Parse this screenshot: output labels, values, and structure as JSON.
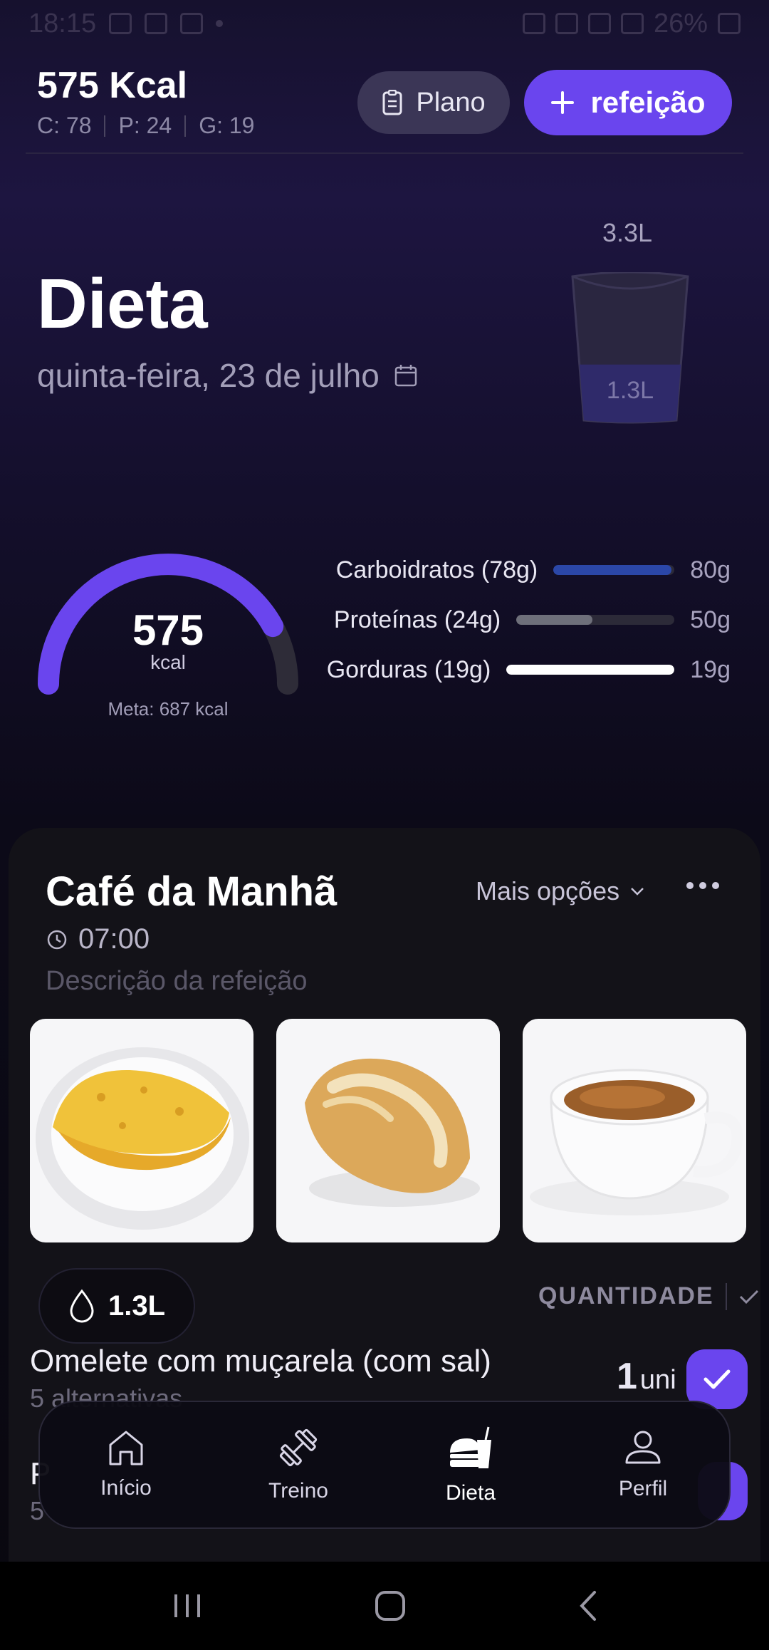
{
  "status_bar": {
    "time": "18:15",
    "battery": "26%"
  },
  "header": {
    "kcal": "575 Kcal",
    "macros": [
      "C: 78",
      "P: 24",
      "G: 19"
    ],
    "plano_label": "Plano",
    "add_meal_label": "refeição",
    "accent": "#6a45ee"
  },
  "page": {
    "title": "Dieta",
    "date": "quinta-feira, 23 de julho"
  },
  "water": {
    "goal": "3.3L",
    "current": "1.3L",
    "fill_fraction": 0.39
  },
  "calories": {
    "value": "575",
    "unit": "kcal",
    "goal_label": "Meta: 687 kcal",
    "fraction": 0.84
  },
  "macro_bars": [
    {
      "label": "Carboidratos (78g)",
      "goal": "80g",
      "fraction": 0.975,
      "color": "#2b47a8"
    },
    {
      "label": "Proteínas (24g)",
      "goal": "50g",
      "fraction": 0.48,
      "color": "#6e6f7a"
    },
    {
      "label": "Gorduras (19g)",
      "goal": "19g",
      "fraction": 1.0,
      "color": "#ffffff"
    }
  ],
  "meal": {
    "title": "Café da Manhã",
    "time": "07:00",
    "description": "Descrição da refeição",
    "more_options": "Mais opções",
    "quantity_header": "QUANTIDADE",
    "foods": [
      {
        "name": "Omelete com muçarela (com sal)",
        "alternatives": "5 alternativas",
        "qty": "1",
        "unit": "uni"
      }
    ],
    "row2_letter": "P",
    "row2_num": "5"
  },
  "water_chip": "1.3L",
  "nav": [
    "Início",
    "Treino",
    "Dieta",
    "Perfil"
  ]
}
